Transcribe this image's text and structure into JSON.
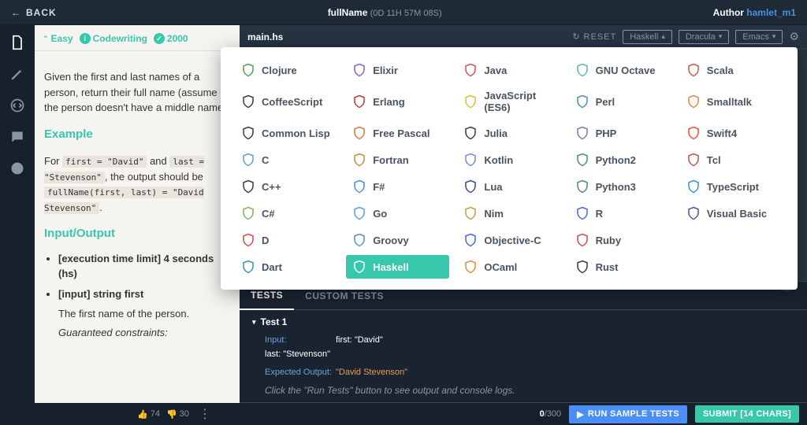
{
  "topbar": {
    "back": "BACK",
    "title": "fullName",
    "time": "(0D 11H 57M 08S)",
    "author_label": "Author",
    "author_name": "hamlet_m1"
  },
  "rail": {
    "items": [
      "file",
      "edit",
      "code",
      "chat",
      "info"
    ]
  },
  "meta": {
    "easy": "Easy",
    "codewriting": "Codewriting",
    "points": "2000"
  },
  "problem": {
    "desc": "Given the first and last names of a person, return their full name (assume the person doesn't have a middle name).",
    "example_h": "Example",
    "example_1": "For ",
    "example_c1": "first = \"David\"",
    "example_2": " and ",
    "example_c2": "last = \"Stevenson\"",
    "example_3": ", the output should be ",
    "example_c3": "fullName(first, last) = \"David Stevenson\"",
    "example_4": ".",
    "io_h": "Input/Output",
    "li1": "[execution time limit] 4 seconds (hs)",
    "li2": "[input] string first",
    "li2_desc": "The first name of the person.",
    "li2_gc": "Guaranteed constraints:"
  },
  "toolbar": {
    "filename": "main.hs",
    "reset": "RESET",
    "lang": "Haskell",
    "theme": "Dracula",
    "keymap": "Emacs"
  },
  "tests": {
    "tab_tests": "TESTS",
    "tab_custom": "CUSTOM TESTS",
    "t1": "Test 1",
    "input_label": "Input:",
    "input_val": "first: \"David\"\nlast: \"Stevenson\"",
    "expected_label": "Expected Output:",
    "expected_val": "\"David Stevenson\"",
    "hint": "Click the \"Run Tests\" button to see output and console logs."
  },
  "bottom": {
    "up": "74",
    "down": "30",
    "chars_cur": "0",
    "chars_max": "/300",
    "run": "RUN SAMPLE TESTS",
    "submit": "SUBMIT [14 CHARS]"
  },
  "languages": [
    [
      "Clojure",
      "#4fa24f"
    ],
    [
      "Elixir",
      "#8a5fc1"
    ],
    [
      "Java",
      "#d94f4f"
    ],
    [
      "GNU Octave",
      "#5ab5b2"
    ],
    [
      "Scala",
      "#d94f4f"
    ],
    [
      "CoffeeScript",
      "#3a3a3a"
    ],
    [
      "Erlang",
      "#b73b3b"
    ],
    [
      "JavaScript (ES6)",
      "#e2b93b"
    ],
    [
      "Perl",
      "#4a8fb8"
    ],
    [
      "Smalltalk",
      "#e08a3b"
    ],
    [
      "Common Lisp",
      "#3a3a3a"
    ],
    [
      "Free Pascal",
      "#d97a3b"
    ],
    [
      "Julia",
      "#3a3a3a"
    ],
    [
      "PHP",
      "#7a7aa8"
    ],
    [
      "Swift4",
      "#f05138"
    ],
    [
      "C",
      "#5aa0d8"
    ],
    [
      "Fortran",
      "#c48a3b"
    ],
    [
      "Kotlin",
      "#6a8fd8"
    ],
    [
      "Python2",
      "#4a8f6a"
    ],
    [
      "Tcl",
      "#c44f4f"
    ],
    [
      "C++",
      "#3a3a3a"
    ],
    [
      "F#",
      "#4a8fd8"
    ],
    [
      "Lua",
      "#3a4a8a"
    ],
    [
      "Python3",
      "#4a8f6a"
    ],
    [
      "TypeScript",
      "#3a8fd8"
    ],
    [
      "C#",
      "#7ab55c"
    ],
    [
      "Go",
      "#5aa0d8"
    ],
    [
      "Nim",
      "#c4a03b"
    ],
    [
      "R",
      "#4a6ad8"
    ],
    [
      "Visual Basic",
      "#6a4aa8"
    ],
    [
      "D",
      "#c44f4f"
    ],
    [
      "Groovy",
      "#5a8fb8"
    ],
    [
      "Objective-C",
      "#3a6ad8"
    ],
    [
      "Ruby",
      "#c44f4f"
    ],
    [
      "",
      ""
    ],
    [
      "Dart",
      "#3a8fb8"
    ],
    [
      "Haskell",
      "#ffffff"
    ],
    [
      "OCaml",
      "#e08a3b"
    ],
    [
      "Rust",
      "#3a3a3a"
    ],
    [
      "",
      ""
    ]
  ],
  "selected_lang": "Haskell"
}
